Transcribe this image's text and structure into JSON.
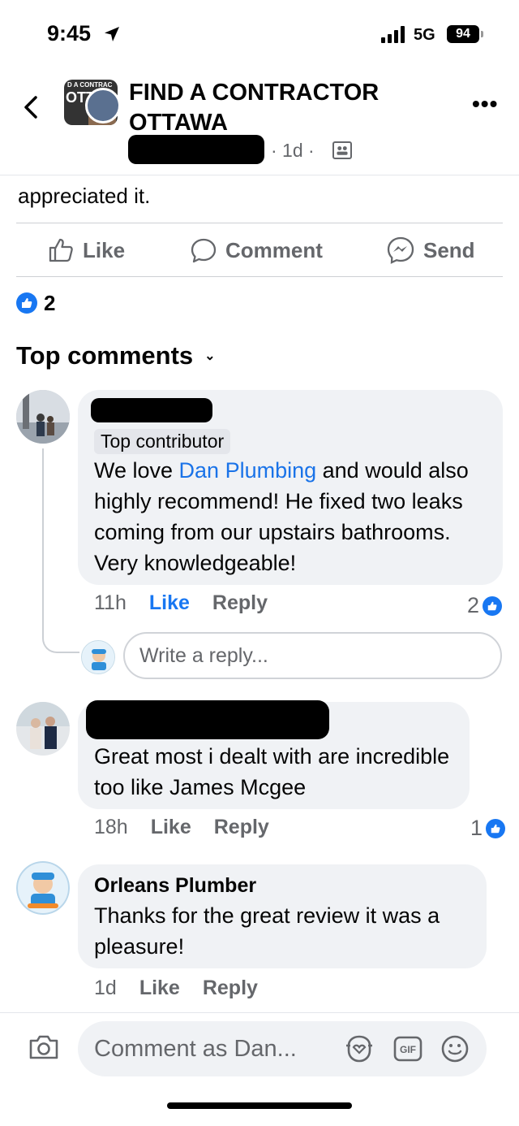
{
  "status_bar": {
    "time": "9:45",
    "network": "5G",
    "battery": "94"
  },
  "header": {
    "group_name": "FIND A CONTRACTOR OTTAWA",
    "avatar_text_top": "D A CONTRAC",
    "avatar_text_big": "OTT",
    "meta_time": "· 1d ·"
  },
  "post": {
    "tail_text": "appreciated it.",
    "actions": {
      "like": "Like",
      "comment": "Comment",
      "send": "Send"
    },
    "reaction_count": "2"
  },
  "comments_section": {
    "sort_label": "Top comments"
  },
  "comments": [
    {
      "badge": "Top contributor",
      "text_before_link": "We love ",
      "link_text": "Dan Plumbing",
      "text_after_link": " and would also highly recommend! He fixed two leaks coming from our upstairs bathrooms. Very knowledgeable!",
      "time": "11h",
      "like_label": "Like",
      "reply_label": "Reply",
      "like_count": "2"
    },
    {
      "text": "Great most i dealt with are incredible too like James Mcgee",
      "time": "18h",
      "like_label": "Like",
      "reply_label": "Reply",
      "like_count": "1"
    },
    {
      "author": "Orleans Plumber",
      "text": "Thanks for the great review it was a pleasure!",
      "time": "1d",
      "like_label": "Like",
      "reply_label": "Reply"
    }
  ],
  "reply_box": {
    "placeholder": "Write a reply..."
  },
  "composer": {
    "placeholder": "Comment as Dan...",
    "gif_label": "GIF"
  },
  "colors": {
    "brand_blue": "#1877f2",
    "link_blue": "#1a73e8",
    "bubble_gray": "#f0f2f5",
    "secondary_text": "#65676b"
  },
  "icons": [
    "location-arrow-icon",
    "signal-icon",
    "battery-icon",
    "back-chevron-icon",
    "more-icon",
    "group-audience-icon",
    "thumbs-up-icon",
    "comment-icon",
    "messenger-send-icon",
    "like-badge-icon",
    "chevron-down-icon",
    "camera-icon",
    "avatar-sticker-icon",
    "gif-icon",
    "smiley-icon"
  ]
}
